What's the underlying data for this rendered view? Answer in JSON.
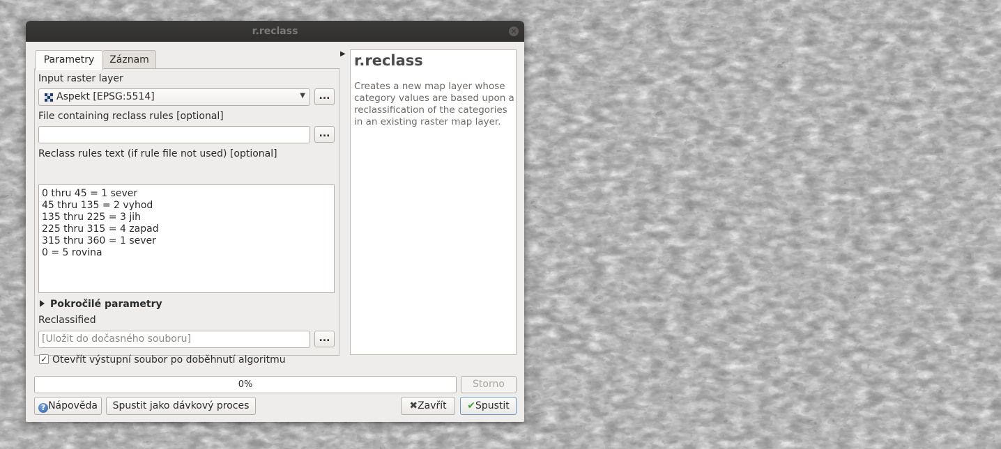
{
  "window": {
    "title": "r.reclass"
  },
  "tabs": [
    {
      "label": "Parametry"
    },
    {
      "label": "Záznam"
    }
  ],
  "params": {
    "input_raster_label": "Input raster layer",
    "input_raster_value": "Aspekt [EPSG:5514]",
    "rules_file_label": "File containing reclass rules [optional]",
    "rules_file_value": "",
    "rules_text_label": "Reclass rules text (if rule file not used) [optional]",
    "rules_lines": [
      "0 thru 45 = 1 sever",
      "45 thru 135 = 2 vyhod",
      "135 thru 225 = 3 jih",
      "225 thru 315 = 4 zapad",
      "315 thru 360 = 1 sever",
      "0 = 5 rovina"
    ],
    "advanced_label": "Pokročilé parametry",
    "output_label": "Reclassified",
    "output_placeholder": "[Uložit do dočasného souboru]",
    "open_output_label": "Otevřít výstupní soubor po doběhnutí algoritmu",
    "open_output_checked": true,
    "browse_label": "..."
  },
  "help": {
    "title": "r.reclass",
    "description": "Creates a new map layer whose category values are based upon a reclassification of the categories in an existing raster map layer."
  },
  "progress": {
    "text": "0%",
    "value": 0
  },
  "buttons": {
    "cancel": "Storno",
    "help": "Nápověda",
    "batch": "Spustit jako dávkový proces",
    "close": "Zavřít",
    "run": "Spustit"
  },
  "icons": {
    "layer": "raster-layer-icon",
    "help": "question-icon",
    "close": "x-icon",
    "run": "checkmark-icon"
  }
}
